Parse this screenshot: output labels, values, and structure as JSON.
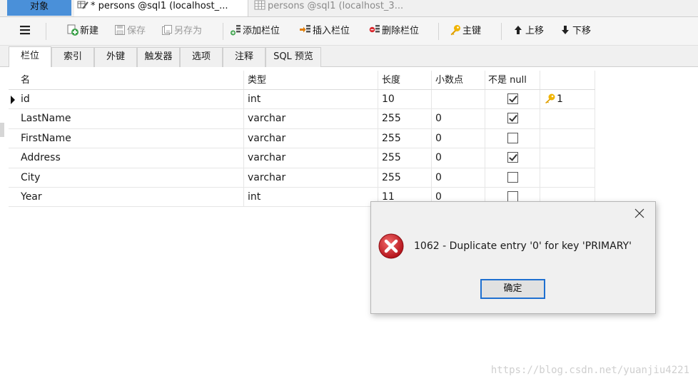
{
  "tabs": {
    "object_label": "对象",
    "active_tab": "* persons @sql1 (localhost_...",
    "inactive_tab": "persons @sql1 (localhost_3..."
  },
  "toolbar": {
    "new": "新建",
    "save": "保存",
    "save_as": "另存为",
    "add_column": "添加栏位",
    "insert_column": "插入栏位",
    "delete_column": "删除栏位",
    "primary_key": "主键",
    "move_up": "上移",
    "move_down": "下移"
  },
  "subtabs": [
    "栏位",
    "索引",
    "外键",
    "触发器",
    "选项",
    "注释",
    "SQL 预览"
  ],
  "grid": {
    "headers": {
      "name": "名",
      "type": "类型",
      "length": "长度",
      "decimals": "小数点",
      "not_null": "不是 null"
    },
    "rows": [
      {
        "name": "id",
        "type": "int",
        "length": "10",
        "decimals": "",
        "not_null": true,
        "key": "1"
      },
      {
        "name": "LastName",
        "type": "varchar",
        "length": "255",
        "decimals": "0",
        "not_null": true,
        "key": ""
      },
      {
        "name": "FirstName",
        "type": "varchar",
        "length": "255",
        "decimals": "0",
        "not_null": false,
        "key": ""
      },
      {
        "name": "Address",
        "type": "varchar",
        "length": "255",
        "decimals": "0",
        "not_null": true,
        "key": ""
      },
      {
        "name": "City",
        "type": "varchar",
        "length": "255",
        "decimals": "0",
        "not_null": false,
        "key": ""
      },
      {
        "name": "Year",
        "type": "int",
        "length": "11",
        "decimals": "0",
        "not_null": false,
        "key": ""
      }
    ]
  },
  "dialog": {
    "message": "1062 - Duplicate entry '0' for key 'PRIMARY'",
    "ok_label": "确定"
  },
  "watermark": "https://blog.csdn.net/yuanjiu4221",
  "colors": {
    "object_tab": "#4a90d9",
    "button_focus": "#1e6fd0",
    "error_red": "#d9262c"
  }
}
